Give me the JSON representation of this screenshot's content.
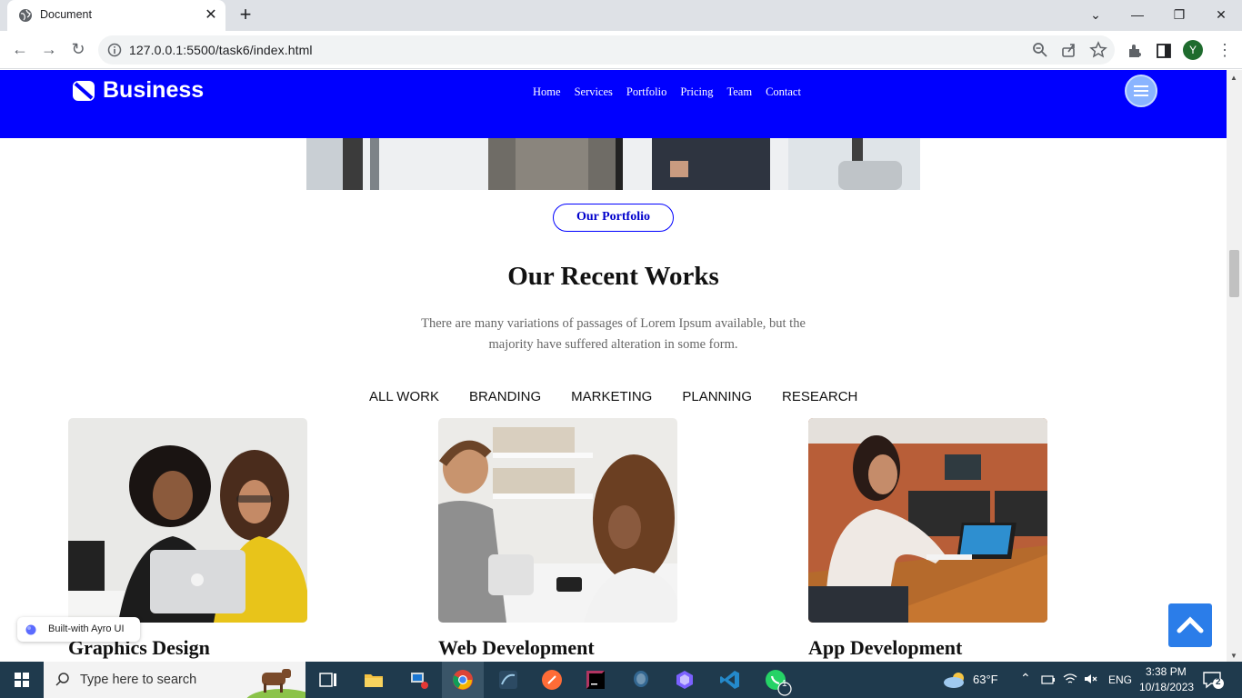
{
  "browser": {
    "tab_title": "Document",
    "url": "127.0.0.1:5500/task6/index.html",
    "profile_initial": "Y"
  },
  "site": {
    "brand": "Business",
    "nav": [
      "Home",
      "Services",
      "Portfolio",
      "Pricing",
      "Team",
      "Contact"
    ],
    "portfolio_button": "Our Portfolio",
    "section_title": "Our Recent Works",
    "section_desc": "There are many variations of passages of Lorem Ipsum available, but the majority have suffered alteration in some form.",
    "filters": [
      "ALL WORK",
      "BRANDING",
      "MARKETING",
      "PLANNING",
      "RESEARCH"
    ],
    "cards": [
      {
        "title": "Graphics Design",
        "image": "two women looking at laptop"
      },
      {
        "title": "Web Development",
        "image": "man and woman at shop counter with phone"
      },
      {
        "title": "App Development",
        "image": "woman working at laptop in office"
      }
    ],
    "badge": "Built-with Ayro UI"
  },
  "taskbar": {
    "search_placeholder": "Type here to search",
    "weather": "63°F",
    "language": "ENG",
    "time": "3:38 PM",
    "date": "10/18/2023",
    "notification_count": "2",
    "whatsapp_badge": "1"
  },
  "colors": {
    "header_bg": "#0000ff",
    "accent": "#2b7de9",
    "taskbar_bg": "#1f3a4d"
  }
}
